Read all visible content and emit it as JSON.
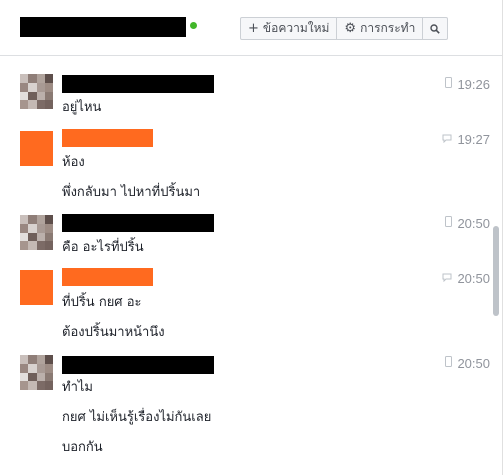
{
  "header": {
    "new_message_label": "ข้อความใหม่",
    "settings_label": "การกระทำ",
    "online_color": "#42b72a",
    "icons": {
      "new": "plus-icon",
      "settings": "gear-icon",
      "search": "search-icon"
    }
  },
  "messages": [
    {
      "avatar": "photo",
      "lines": [
        "อยู่ไหน"
      ],
      "time": "19:26",
      "device": "mobile-icon"
    },
    {
      "avatar": "orange",
      "lines": [
        "ห้อง",
        "พึ่งกลับมา ไปหาที่ปริ้นมา"
      ],
      "time": "19:27",
      "device": "chat-icon"
    },
    {
      "avatar": "photo",
      "lines": [
        "คือ อะไรที่ปริ้น"
      ],
      "time": "20:50",
      "device": "mobile-icon"
    },
    {
      "avatar": "orange",
      "lines": [
        "ที่ปริ้น กยศ อะ",
        "ต้องปริ้นมาหน้านึง"
      ],
      "time": "20:50",
      "device": "chat-icon"
    },
    {
      "avatar": "photo",
      "lines": [
        "ทำไม",
        "กยศ ไม่เห็นรู้เรื่องไม่กันเลย",
        "บอกกัน"
      ],
      "time": "20:50",
      "device": "mobile-icon"
    }
  ]
}
